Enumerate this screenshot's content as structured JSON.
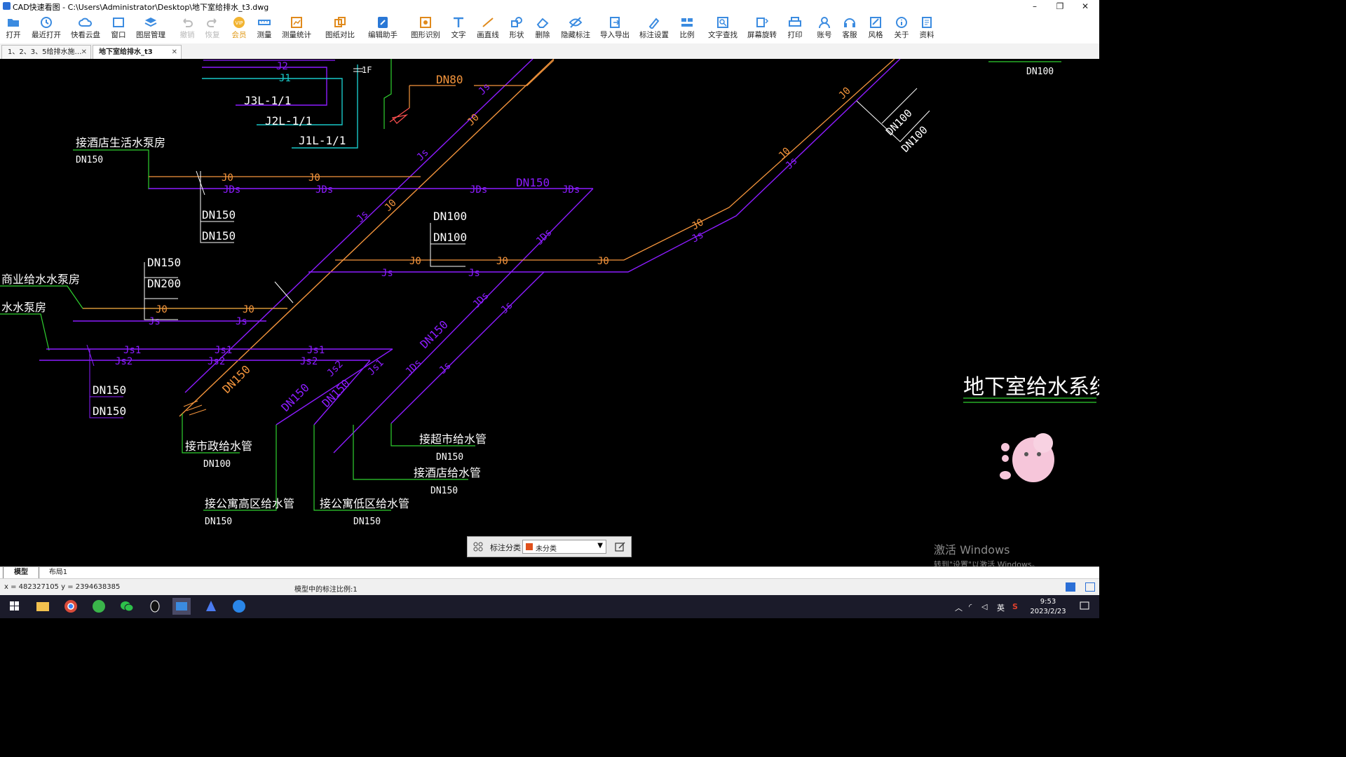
{
  "window": {
    "title": "CAD快速看图 - C:\\Users\\Administrator\\Desktop\\地下室给排水_t3.dwg",
    "minimize": "–",
    "maximize": "❐",
    "close": "✕"
  },
  "toolbar": {
    "items": [
      {
        "label": "打开",
        "icon": "folder-open-icon"
      },
      {
        "label": "最近打开",
        "icon": "history-icon"
      },
      {
        "label": "快看云盘",
        "icon": "cloud-icon"
      },
      {
        "label": "窗口",
        "icon": "window-icon"
      },
      {
        "label": "图层管理",
        "icon": "layers-icon"
      },
      {
        "label": "撤销",
        "icon": "undo-icon"
      },
      {
        "label": "恢复",
        "icon": "redo-icon"
      },
      {
        "label": "会员",
        "icon": "vip-icon"
      },
      {
        "label": "测量",
        "icon": "ruler-icon"
      },
      {
        "label": "测量统计",
        "icon": "measure-stats-icon"
      },
      {
        "label": "图纸对比",
        "icon": "compare-icon"
      },
      {
        "label": "编辑助手",
        "icon": "edit-helper-icon"
      },
      {
        "label": "图形识别",
        "icon": "shape-recognize-icon"
      },
      {
        "label": "文字",
        "icon": "text-icon"
      },
      {
        "label": "画直线",
        "icon": "line-icon"
      },
      {
        "label": "形状",
        "icon": "shape-icon"
      },
      {
        "label": "删除",
        "icon": "eraser-icon"
      },
      {
        "label": "隐藏标注",
        "icon": "eye-hide-icon"
      },
      {
        "label": "导入导出",
        "icon": "import-export-icon"
      },
      {
        "label": "标注设置",
        "icon": "annotation-settings-icon"
      },
      {
        "label": "比例",
        "icon": "scale-icon"
      },
      {
        "label": "文字查找",
        "icon": "text-search-icon"
      },
      {
        "label": "屏幕旋转",
        "icon": "rotate-icon"
      },
      {
        "label": "打印",
        "icon": "printer-icon"
      },
      {
        "label": "账号",
        "icon": "user-icon"
      },
      {
        "label": "客服",
        "icon": "headset-icon"
      },
      {
        "label": "风格",
        "icon": "style-icon"
      },
      {
        "label": "关于",
        "icon": "info-icon"
      },
      {
        "label": "资料",
        "icon": "documents-icon"
      }
    ]
  },
  "tabs": [
    {
      "label": "1、2、3、5给排水施…",
      "close": "✕"
    },
    {
      "label": "地下室给排水_t3",
      "close": "✕"
    }
  ],
  "drawing": {
    "labels": {
      "j2": "J2",
      "j1": "J1",
      "f1": "1F",
      "j3l": "J3L-1/1",
      "j2l": "J2L-1/1",
      "j1l": "J1L-1/1",
      "hotel_pump": "接酒店生活水泵房",
      "hotel_pump_dn": "DN150",
      "dn80": "DN80",
      "js": "Js",
      "jo": "J0",
      "jds": "JDs",
      "dn150": "DN150",
      "dn200": "DN200",
      "dn100": "DN100",
      "commercial_pump": "商业给水水泵房",
      "pump2": "水水泵房",
      "js1": "Js1",
      "js2": "Js2",
      "municipal": "接市政给水管",
      "municipal_dn": "DN100",
      "apt_high": "接公寓高区给水管",
      "apt_high_dn": "DN150",
      "apt_low": "接公寓低区给水管",
      "apt_low_dn": "DN150",
      "supermarket": "接超市给水管",
      "supermarket_dn": "DN150",
      "hotel": "接酒店给水管",
      "hotel_dn": "DN150",
      "drawing_title": "地下室给水系统图"
    },
    "colors": {
      "purple": "#8c1cff",
      "orange": "#f5953c",
      "green": "#2fd02f",
      "cyan": "#19c8c8",
      "white": "#ffffff",
      "blue": "#5a5aff"
    }
  },
  "annotation_bar": {
    "label": "标注分类",
    "selected": "未分类",
    "swatch_color": "#e0501c"
  },
  "watermark": {
    "line1": "激活 Windows",
    "line2": "转到\"设置\"以激活 Windows。"
  },
  "layout_tabs": [
    "模型",
    "布局1"
  ],
  "status": {
    "coords": "x = 482327105  y = 2394638385",
    "scale_text": "模型中的标注比例:1"
  },
  "taskbar": {
    "apps": [
      "start-icon",
      "explorer-icon",
      "chrome-icon",
      "browser360-icon",
      "wechat-icon",
      "qq-icon",
      "cad-viewer-icon",
      "cad-app-icon",
      "sogou-icon"
    ],
    "tray": {
      "ime": "英",
      "time": "9:53",
      "date": "2023/2/23"
    }
  }
}
